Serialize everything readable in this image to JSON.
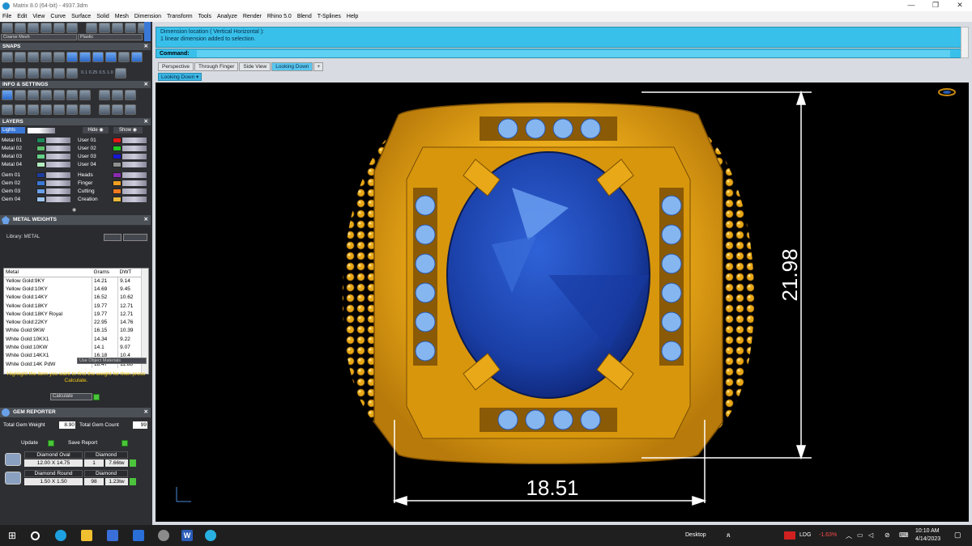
{
  "window": {
    "title": "Matrix 8.0 (64-bit) - 4937.3dm"
  },
  "menu": [
    "File",
    "Edit",
    "View",
    "Curve",
    "Surface",
    "Solid",
    "Mesh",
    "Dimension",
    "Transform",
    "Tools",
    "Analyze",
    "Render",
    "Rhino 5.0",
    "Blend",
    "T-Splines",
    "Help"
  ],
  "toolbar": {
    "mesh_option": "Coarse Mesh",
    "material_option": "Plastic"
  },
  "snaps": {
    "title": "SNAPS",
    "values": [
      "0.1",
      "0.25",
      "0.5",
      "1.0"
    ]
  },
  "info_settings": {
    "title": "INFO & SETTINGS"
  },
  "layers": {
    "title": "LAYERS",
    "lights_label": "Lights",
    "hide_label": "Hide",
    "show_label": "Show",
    "left": [
      {
        "name": "Metal 01",
        "color": "#1e8a5a"
      },
      {
        "name": "Metal 02",
        "color": "#5ec06e"
      },
      {
        "name": "Metal 03",
        "color": "#66d08a"
      },
      {
        "name": "Metal 04",
        "color": "#b4eec0"
      },
      {
        "name": "Gem 01",
        "color": "#1c3c9c"
      },
      {
        "name": "Gem 02",
        "color": "#3a78d8"
      },
      {
        "name": "Gem 03",
        "color": "#6aa0e8"
      },
      {
        "name": "Gem 04",
        "color": "#9cc4f0"
      }
    ],
    "right": [
      {
        "name": "User 01",
        "color": "#e01818"
      },
      {
        "name": "User 02",
        "color": "#22c822"
      },
      {
        "name": "User 03",
        "color": "#1818d0"
      },
      {
        "name": "User 04",
        "color": "#909090"
      },
      {
        "name": "Heads",
        "color": "#8a2ab0"
      },
      {
        "name": "Finger",
        "color": "#f0a020"
      },
      {
        "name": "Cutting",
        "color": "#f07820"
      },
      {
        "name": "Creation",
        "color": "#e8b838"
      }
    ]
  },
  "metal_weights": {
    "title": "METAL WEIGHTS",
    "library_label": "Library: METAL",
    "columns": [
      "Metal",
      "Grams",
      "DWT"
    ],
    "rows": [
      [
        "Yellow Gold:9KY",
        "14.21",
        "9.14"
      ],
      [
        "Yellow Gold:10KY",
        "14.69",
        "9.45"
      ],
      [
        "Yellow Gold:14KY",
        "16.52",
        "10.62"
      ],
      [
        "Yellow Gold:18KY",
        "19.77",
        "12.71"
      ],
      [
        "Yellow Gold:18KY Royal",
        "19.77",
        "12.71"
      ],
      [
        "Yellow Gold:22KY",
        "22.95",
        "14.76"
      ],
      [
        "White Gold:9KW",
        "16.15",
        "10.39"
      ],
      [
        "White Gold:10KX1",
        "14.34",
        "9.22"
      ],
      [
        "White Gold:10KW",
        "14.1",
        "9.07"
      ],
      [
        "White Gold:14KX1",
        "16.18",
        "10.4"
      ],
      [
        "White Gold:14K PdW",
        "18.47",
        "11.88"
      ]
    ],
    "object_materials_label": "Use Object Materials",
    "hint": "Highlight the item you want to find the weight for then press Calculate.",
    "calculate_label": "Calculate"
  },
  "gem_reporter": {
    "title": "GEM REPORTER",
    "total_weight_label": "Total Gem Weight",
    "total_weight_value": "8.90",
    "total_count_label": "Total Gem Count",
    "total_count_value": "99",
    "update_label": "Update",
    "save_label": "Save Report",
    "gems": [
      {
        "shape": "Diamond Oval",
        "size": "12.00 X 14.75",
        "material": "Diamond",
        "count": "1",
        "weight": "7.66tw"
      },
      {
        "shape": "Diamond Round",
        "size": "1.50 X 1.50",
        "material": "Diamond",
        "count": "98",
        "weight": "1.23tw"
      }
    ]
  },
  "command": {
    "history": [
      "Dimension location ( Vertical  Horizontal ):",
      "1 linear dimension added to selection."
    ],
    "prompt_label": "Command:",
    "value": ""
  },
  "view_tabs": [
    "Perspective",
    "Through Finger",
    "Side View",
    "Looking Down"
  ],
  "active_tab": "Looking Down",
  "view_label": "Looking Down",
  "dimensions": {
    "horizontal": "18.51",
    "vertical": "21.98"
  },
  "taskbar": {
    "desktop_label": "Desktop",
    "ticker": "LDG",
    "ticker_change": "-1.63%",
    "time": "10:10 AM",
    "date": "4/14/2023"
  },
  "colors": {
    "gold": "#e8a818",
    "sapphire": "#1d48b8",
    "accent": "#38c0ea"
  }
}
